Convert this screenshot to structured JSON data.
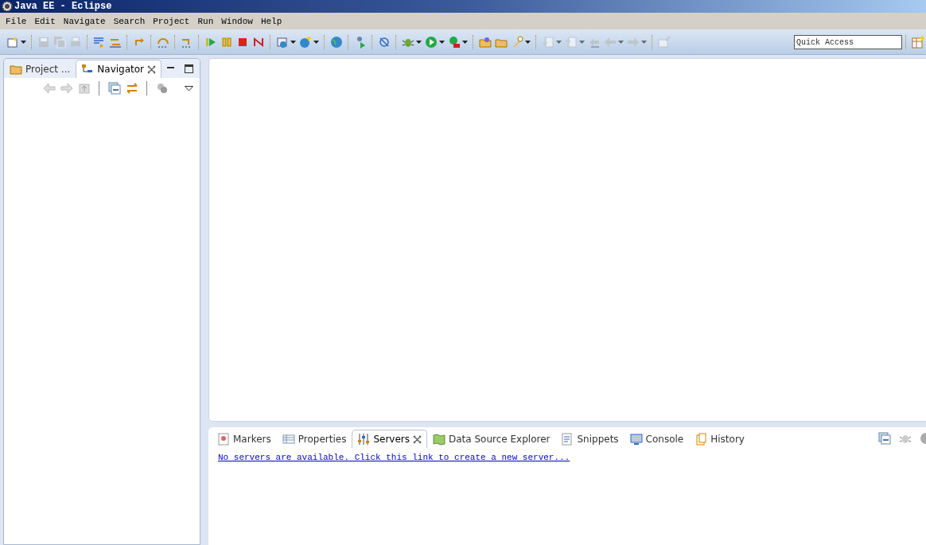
{
  "window": {
    "title": "Java EE - Eclipse"
  },
  "menu": [
    "File",
    "Edit",
    "Navigate",
    "Search",
    "Project",
    "Run",
    "Window",
    "Help"
  ],
  "toolbar": {
    "buttons": [
      {
        "disabled": false,
        "dropdown": true
      },
      {
        "disabled": true,
        "dropdown": false
      },
      {
        "disabled": true,
        "dropdown": false
      },
      {
        "disabled": true,
        "dropdown": false
      },
      {
        "disabled": false,
        "dropdown": false
      },
      {
        "disabled": false,
        "dropdown": false
      },
      {
        "disabled": false,
        "dropdown": false
      },
      {
        "disabled": false,
        "dropdown": false
      },
      {
        "disabled": false,
        "dropdown": false
      },
      {
        "disabled": false,
        "dropdown": false
      },
      {
        "disabled": false,
        "dropdown": false
      },
      {
        "disabled": false,
        "dropdown": false
      },
      {
        "disabled": false,
        "dropdown": false
      },
      {
        "disabled": false,
        "dropdown": true
      },
      {
        "disabled": false,
        "dropdown": true
      },
      {
        "disabled": false,
        "dropdown": false
      },
      {
        "disabled": false,
        "dropdown": false
      },
      {
        "disabled": false,
        "dropdown": false
      },
      {
        "disabled": false,
        "dropdown": true
      },
      {
        "disabled": false,
        "dropdown": true
      },
      {
        "disabled": false,
        "dropdown": true
      },
      {
        "disabled": false,
        "dropdown": false
      },
      {
        "disabled": false,
        "dropdown": false
      },
      {
        "disabled": false,
        "dropdown": true
      },
      {
        "disabled": true,
        "dropdown": true
      },
      {
        "disabled": true,
        "dropdown": true
      },
      {
        "disabled": true,
        "dropdown": false
      },
      {
        "disabled": true,
        "dropdown": true
      },
      {
        "disabled": true,
        "dropdown": true
      },
      {
        "disabled": true,
        "dropdown": false
      }
    ],
    "quick_access": {
      "placeholder": "Quick Access"
    }
  },
  "left_panel": {
    "tabs": [
      {
        "label": "Project ...",
        "selected": false
      },
      {
        "label": "Navigator",
        "selected": true
      }
    ]
  },
  "bottom_panel": {
    "tabs": [
      {
        "label": "Markers",
        "selected": false
      },
      {
        "label": "Properties",
        "selected": false
      },
      {
        "label": "Servers",
        "selected": true
      },
      {
        "label": "Data Source Explorer",
        "selected": false
      },
      {
        "label": "Snippets",
        "selected": false
      },
      {
        "label": "Console",
        "selected": false
      },
      {
        "label": "History",
        "selected": false
      }
    ],
    "link": "No servers are available. Click this link to create a new server..."
  }
}
